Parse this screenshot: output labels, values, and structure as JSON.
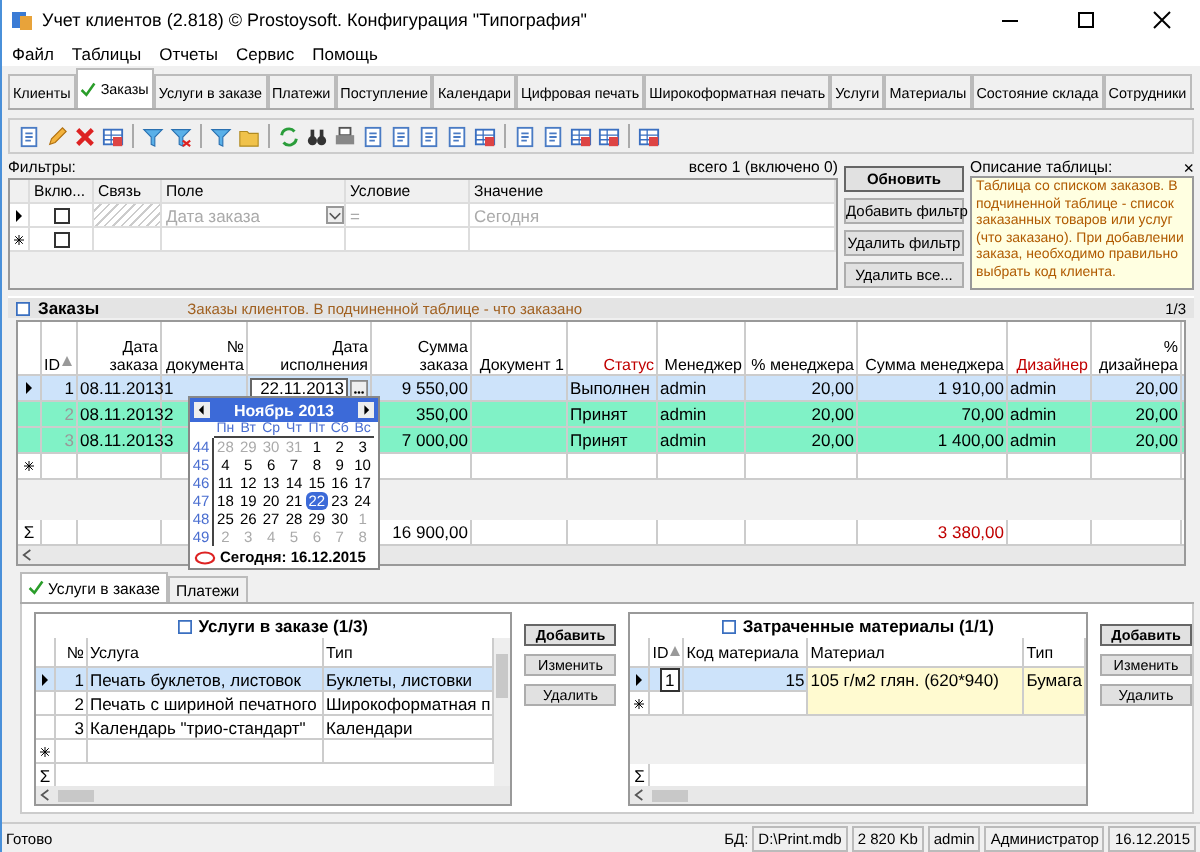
{
  "window": {
    "title": "Учет клиентов (2.818) © Prostoysoft. Конфигурация \"Типография\""
  },
  "menu": [
    "Файл",
    "Таблицы",
    "Отчеты",
    "Сервис",
    "Помощь"
  ],
  "tabs": [
    {
      "label": "Клиенты",
      "selected": false
    },
    {
      "label": "Заказы",
      "selected": true
    },
    {
      "label": "Услуги в заказе",
      "selected": false
    },
    {
      "label": "Платежи",
      "selected": false
    },
    {
      "label": "Поступление",
      "selected": false
    },
    {
      "label": "Календари",
      "selected": false
    },
    {
      "label": "Цифровая печать",
      "selected": false
    },
    {
      "label": "Широкоформатная печать",
      "selected": false
    },
    {
      "label": "Услуги",
      "selected": false
    },
    {
      "label": "Материалы",
      "selected": false
    },
    {
      "label": "Состояние склада",
      "selected": false
    },
    {
      "label": "Сотрудники",
      "selected": false
    }
  ],
  "filters": {
    "title": "Фильтры:",
    "summary": "всего 1 (включено 0)",
    "columns": [
      "Вклю...",
      "Связь",
      "Поле",
      "Условие",
      "Значение"
    ],
    "rows": [
      {
        "checked": false,
        "field": "Дата заказа",
        "condition": "=",
        "value": "Сегодня"
      }
    ],
    "new_row": {
      "checked": false
    },
    "buttons": [
      {
        "label": "Обновить",
        "primary": true
      },
      {
        "label": "Добавить фильтр",
        "primary": false
      },
      {
        "label": "Удалить фильтр",
        "primary": false
      },
      {
        "label": "Удалить все...",
        "primary": false
      }
    ],
    "description_title": "Описание таблицы:",
    "close": "×",
    "description": "Таблица со списком заказов. В подчиненной таблице - список заказанных товаров или услуг (что заказано). При добавлении заказа, необходимо правильно выбрать код клиента."
  },
  "orders": {
    "title": "Заказы",
    "description": "Заказы клиентов. В подчиненной таблице - что заказано",
    "pager": "1/3",
    "columns": [
      {
        "label": "ID",
        "highlight": false,
        "sort": true
      },
      {
        "label": "Дата заказа",
        "highlight": false,
        "sort": false
      },
      {
        "label": "№ документа",
        "highlight": false,
        "sort": false
      },
      {
        "label": "Дата исполнения",
        "highlight": false,
        "sort": false
      },
      {
        "label": "Сумма заказа",
        "highlight": false,
        "sort": false
      },
      {
        "label": "Документ 1",
        "highlight": false,
        "sort": false
      },
      {
        "label": "Статус",
        "highlight": true,
        "sort": false
      },
      {
        "label": "Менеджер",
        "highlight": false,
        "sort": false
      },
      {
        "label": "% менеджера",
        "highlight": false,
        "sort": false
      },
      {
        "label": "Сумма менеджера",
        "highlight": false,
        "sort": false
      },
      {
        "label": "Дизайнер",
        "highlight": true,
        "sort": false
      },
      {
        "label": "% дизайнера",
        "highlight": false,
        "sort": false
      }
    ],
    "rows": [
      {
        "selected": true,
        "cells": [
          "1",
          "08.11.2013",
          "1",
          "22.11.2013",
          "9 550,00",
          null,
          "Выполнен",
          "admin",
          "20,00",
          "1 910,00",
          "admin",
          "20,00"
        ]
      },
      {
        "selected": false,
        "color": "#80f2c6",
        "cells": [
          "2",
          "08.11.2013",
          "2",
          null,
          "350,00",
          null,
          "Принят",
          "admin",
          "20,00",
          "70,00",
          "admin",
          "20,00"
        ]
      },
      {
        "selected": false,
        "color": "#80f2c6",
        "cells": [
          "3",
          "08.11.2013",
          "3",
          null,
          "7 000,00",
          null,
          "Принят",
          "admin",
          "20,00",
          "1 400,00",
          "admin",
          "20,00"
        ]
      }
    ],
    "sum_symbol": "Σ",
    "totals": {
      "order_sum": "16 900,00",
      "manager_sum": "3 380,00"
    }
  },
  "calendar": {
    "month": "Ноябрь 2013",
    "weekdays": [
      "Пн",
      "Вт",
      "Ср",
      "Чт",
      "Пт",
      "Сб",
      "Вс"
    ],
    "weeks": [
      {
        "week": "44",
        "days": [
          {
            "d": "28",
            "other": true
          },
          {
            "d": "29",
            "other": true
          },
          {
            "d": "30",
            "other": true
          },
          {
            "d": "31",
            "other": true
          },
          {
            "d": "1",
            "other": false
          },
          {
            "d": "2",
            "other": false
          },
          {
            "d": "3",
            "other": false
          }
        ]
      },
      {
        "week": "45",
        "days": [
          {
            "d": "4",
            "other": false
          },
          {
            "d": "5",
            "other": false
          },
          {
            "d": "6",
            "other": false
          },
          {
            "d": "7",
            "other": false
          },
          {
            "d": "8",
            "other": false
          },
          {
            "d": "9",
            "other": false
          },
          {
            "d": "10",
            "other": false
          }
        ]
      },
      {
        "week": "46",
        "days": [
          {
            "d": "11",
            "other": false
          },
          {
            "d": "12",
            "other": false
          },
          {
            "d": "13",
            "other": false
          },
          {
            "d": "14",
            "other": false
          },
          {
            "d": "15",
            "other": false
          },
          {
            "d": "16",
            "other": false
          },
          {
            "d": "17",
            "other": false
          }
        ]
      },
      {
        "week": "47",
        "days": [
          {
            "d": "18",
            "other": false
          },
          {
            "d": "19",
            "other": false
          },
          {
            "d": "20",
            "other": false
          },
          {
            "d": "21",
            "other": false
          },
          {
            "d": "22",
            "other": false,
            "selected": true
          },
          {
            "d": "23",
            "other": false
          },
          {
            "d": "24",
            "other": false
          }
        ]
      },
      {
        "week": "48",
        "days": [
          {
            "d": "25",
            "other": false
          },
          {
            "d": "26",
            "other": false
          },
          {
            "d": "27",
            "other": false
          },
          {
            "d": "28",
            "other": false
          },
          {
            "d": "29",
            "other": false
          },
          {
            "d": "30",
            "other": false
          },
          {
            "d": "1",
            "other": true
          }
        ]
      },
      {
        "week": "49",
        "days": [
          {
            "d": "2",
            "other": true
          },
          {
            "d": "3",
            "other": true
          },
          {
            "d": "4",
            "other": true
          },
          {
            "d": "5",
            "other": true
          },
          {
            "d": "6",
            "other": true
          },
          {
            "d": "7",
            "other": true
          },
          {
            "d": "8",
            "other": true
          }
        ]
      }
    ],
    "today": "Сегодня: 16.12.2015"
  },
  "sub_tabs": [
    {
      "label": "Услуги в заказе",
      "selected": true
    },
    {
      "label": "Платежи",
      "selected": false
    }
  ],
  "services": {
    "title": "Услуги в заказе (1/3)",
    "sum_symbol": "Σ",
    "columns": [
      "№",
      "Услуга",
      "Тип"
    ],
    "rows": [
      {
        "selected": true,
        "cells": [
          "1",
          "Печать буклетов, листовок",
          "Буклеты, листовки"
        ]
      },
      {
        "selected": false,
        "cells": [
          "2",
          "Печать с шириной печатного",
          "Широкоформатная п"
        ]
      },
      {
        "selected": false,
        "cells": [
          "3",
          "Календарь \"трио-стандарт\"",
          "Календари"
        ]
      }
    ],
    "buttons": [
      {
        "label": "Добавить",
        "primary": true
      },
      {
        "label": "Изменить",
        "primary": false
      },
      {
        "label": "Удалить",
        "primary": false
      }
    ]
  },
  "materials": {
    "title": "Затраченные материалы (1/1)",
    "sum_symbol": "Σ",
    "columns": [
      "ID",
      "Код материала",
      "Материал",
      "Тип"
    ],
    "rows": [
      {
        "selected": true,
        "cells": [
          "1",
          "15",
          "105 г/м2 глян. (620*940)",
          "Бумага"
        ]
      }
    ],
    "buttons": [
      {
        "label": "Добавить",
        "primary": true
      },
      {
        "label": "Изменить",
        "primary": false
      },
      {
        "label": "Удалить",
        "primary": false
      }
    ]
  },
  "status_bar": {
    "status": "Готово",
    "db_label": "БД:",
    "fields": [
      "D:\\Print.mdb",
      "2 820 Kb",
      "admin",
      "Администратор",
      "16.12.2015"
    ]
  }
}
